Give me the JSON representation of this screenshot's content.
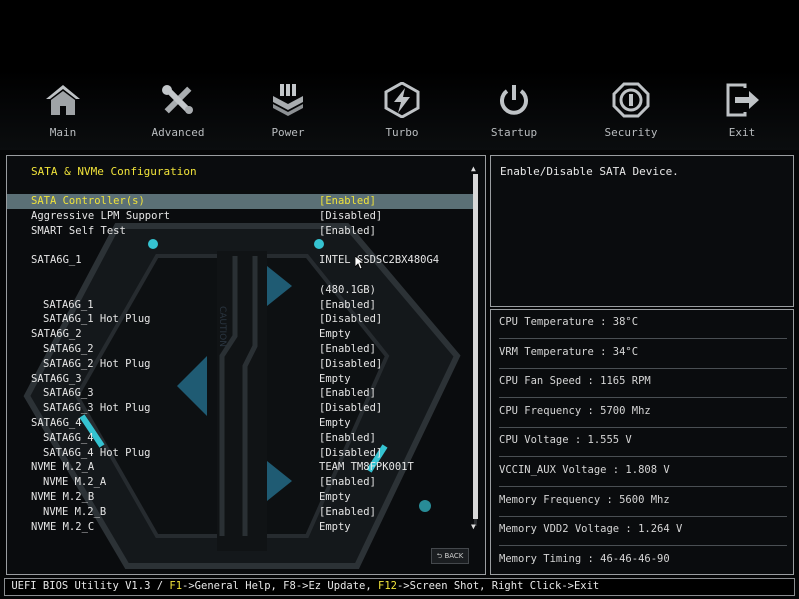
{
  "nav": {
    "items": [
      {
        "label": "Main",
        "icon": "home-icon"
      },
      {
        "label": "Advanced",
        "icon": "tools-icon"
      },
      {
        "label": "Power",
        "icon": "power-chip-icon"
      },
      {
        "label": "Turbo",
        "icon": "bolt-icon"
      },
      {
        "label": "Startup",
        "icon": "power-button-icon"
      },
      {
        "label": "Security",
        "icon": "shield-icon"
      },
      {
        "label": "Exit",
        "icon": "exit-icon"
      }
    ]
  },
  "section_title": "SATA & NVMe Configuration",
  "rows": [
    {
      "label": "SATA Controller(s)",
      "value": "[Enabled]",
      "indent": false,
      "selected": true
    },
    {
      "label": "Aggressive LPM Support",
      "value": "[Disabled]",
      "indent": false
    },
    {
      "label": "SMART Self Test",
      "value": "[Enabled]",
      "indent": false
    },
    {
      "label": "",
      "value": "",
      "indent": false
    },
    {
      "label": "SATA6G_1",
      "value": "INTEL SSDSC2BX480G4",
      "indent": false
    },
    {
      "label": "",
      "value": "",
      "indent": false
    },
    {
      "label": "",
      "value": "(480.1GB)",
      "indent": false
    },
    {
      "label": "SATA6G_1",
      "value": "[Enabled]",
      "indent": true
    },
    {
      "label": "SATA6G_1 Hot Plug",
      "value": "[Disabled]",
      "indent": true
    },
    {
      "label": "SATA6G_2",
      "value": "Empty",
      "indent": false
    },
    {
      "label": "SATA6G_2",
      "value": "[Enabled]",
      "indent": true
    },
    {
      "label": "SATA6G_2 Hot Plug",
      "value": "[Disabled]",
      "indent": true
    },
    {
      "label": "SATA6G_3",
      "value": "Empty",
      "indent": false
    },
    {
      "label": "SATA6G_3",
      "value": "[Enabled]",
      "indent": true
    },
    {
      "label": "SATA6G_3 Hot Plug",
      "value": "[Disabled]",
      "indent": true
    },
    {
      "label": "SATA6G_4",
      "value": "Empty",
      "indent": false
    },
    {
      "label": "SATA6G_4",
      "value": "[Enabled]",
      "indent": true
    },
    {
      "label": "SATA6G_4 Hot Plug",
      "value": "[Disabled]",
      "indent": true
    },
    {
      "label": "NVME M.2_A",
      "value": "TEAM TM8FPK001T",
      "indent": false
    },
    {
      "label": "NVME M.2_A",
      "value": "[Enabled]",
      "indent": true
    },
    {
      "label": "NVME M.2_B",
      "value": "Empty",
      "indent": false
    },
    {
      "label": "NVME M.2_B",
      "value": "[Enabled]",
      "indent": true
    },
    {
      "label": "NVME M.2_C",
      "value": "Empty",
      "indent": false
    }
  ],
  "back_label": "BACK",
  "help_text": "Enable/Disable SATA Device.",
  "hw_monitor": [
    "CPU Temperature : 38°C",
    "VRM Temperature : 34°C",
    "CPU Fan Speed : 1165 RPM",
    "CPU Frequency : 5700 Mhz",
    "CPU Voltage : 1.555 V",
    "VCCIN_AUX Voltage : 1.808 V",
    "Memory Frequency : 5600 Mhz",
    "Memory VDD2 Voltage : 1.264 V",
    "Memory Timing : 46-46-46-90"
  ],
  "statusbar": {
    "prefix": " UEFI BIOS Utility V1.3 / ",
    "f1": "F1",
    "mid1": "->General Help, F8->Ez Update, ",
    "f12": "F12",
    "mid2": "->Screen Shot, Right Click->Exit"
  },
  "colors": {
    "accent": "#f0e33a",
    "selected_row": "#5b7076",
    "teal": "#35c3d1"
  }
}
